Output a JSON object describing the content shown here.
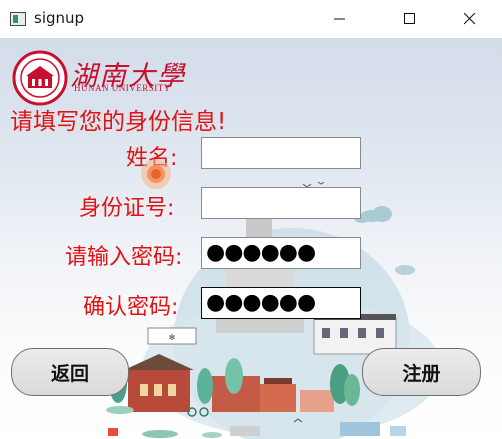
{
  "window": {
    "title": "signup"
  },
  "logo": {
    "name": "湖南大學",
    "subtitle": "HUNAN UNIVERSITY"
  },
  "form": {
    "heading": "请填写您的身份信息!",
    "name_label": "姓名:",
    "name_value": "",
    "id_label": "身份证号:",
    "id_value": "",
    "password_label": "请输入密码:",
    "password_mask": "●●●●●●",
    "confirm_label": "确认密码:",
    "confirm_mask": "●●●●●●"
  },
  "buttons": {
    "back_label": "返回",
    "register_label": "注册"
  },
  "colors": {
    "label_red": "#e31212",
    "brand_red": "#c8102e"
  }
}
